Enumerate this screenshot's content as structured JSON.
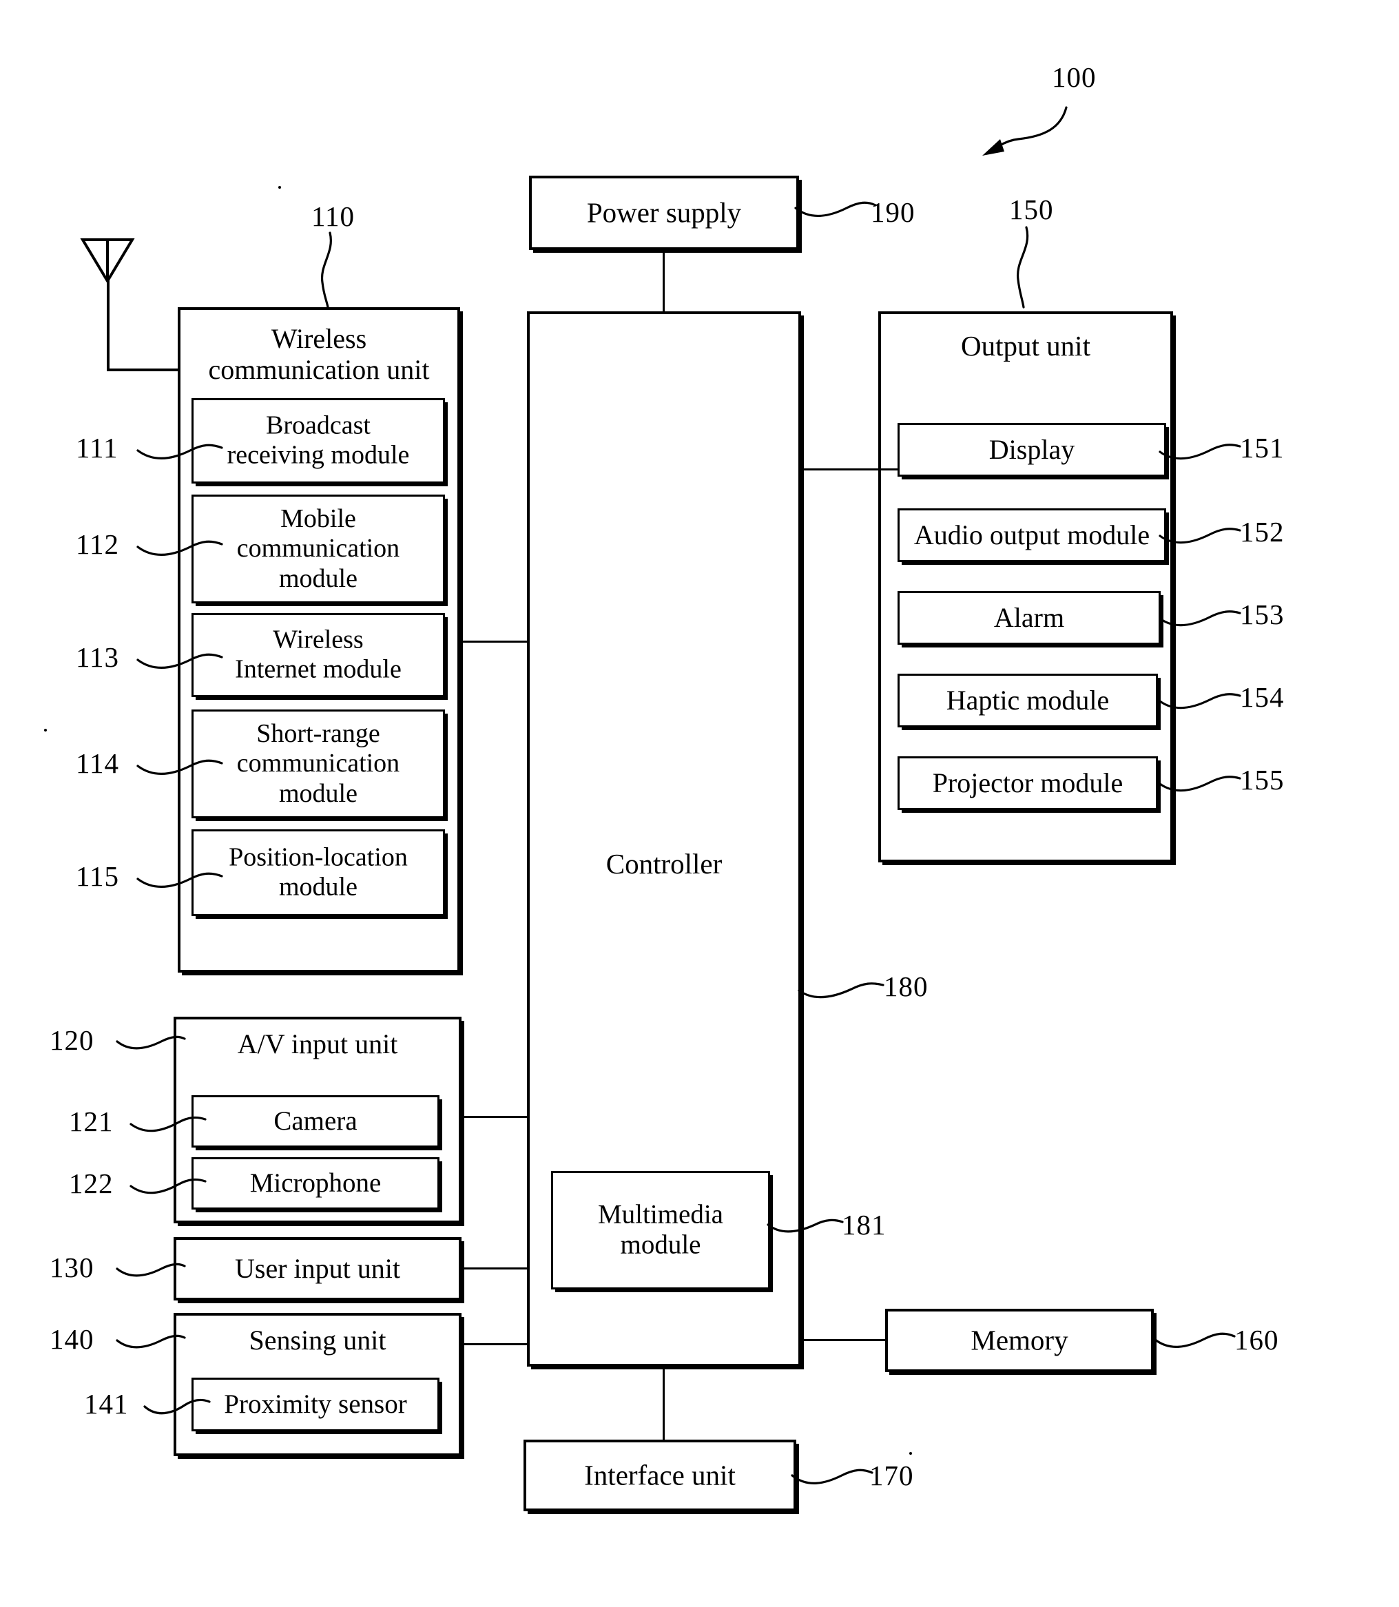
{
  "figure": {
    "device_ref": "100",
    "antenna_icon": "antenna-icon"
  },
  "blocks": {
    "power_supply": {
      "label": "Power supply",
      "ref": "190"
    },
    "controller": {
      "label": "Controller",
      "ref": "180"
    },
    "multimedia_module": {
      "label": "Multimedia\nmodule",
      "ref": "181"
    },
    "memory": {
      "label": "Memory",
      "ref": "160"
    },
    "interface_unit": {
      "label": "Interface unit",
      "ref": "170"
    },
    "user_input_unit": {
      "label": "User input unit",
      "ref": "130"
    }
  },
  "wireless_communication_unit": {
    "title": "Wireless\ncommunication unit",
    "ref": "110",
    "modules": [
      {
        "label": "Broadcast\nreceiving module",
        "ref": "111"
      },
      {
        "label": "Mobile\ncommunication\nmodule",
        "ref": "112"
      },
      {
        "label": "Wireless\nInternet module",
        "ref": "113"
      },
      {
        "label": "Short-range\ncommunication\nmodule",
        "ref": "114"
      },
      {
        "label": "Position-location\nmodule",
        "ref": "115"
      }
    ]
  },
  "output_unit": {
    "title": "Output unit",
    "ref": "150",
    "modules": [
      {
        "label": "Display",
        "ref": "151"
      },
      {
        "label": "Audio output module",
        "ref": "152"
      },
      {
        "label": "Alarm",
        "ref": "153"
      },
      {
        "label": "Haptic module",
        "ref": "154"
      },
      {
        "label": "Projector module",
        "ref": "155"
      }
    ]
  },
  "av_input_unit": {
    "title": "A/V input unit",
    "ref": "120",
    "modules": [
      {
        "label": "Camera",
        "ref": "121"
      },
      {
        "label": "Microphone",
        "ref": "122"
      }
    ]
  },
  "sensing_unit": {
    "title": "Sensing unit",
    "ref": "140",
    "modules": [
      {
        "label": "Proximity sensor",
        "ref": "141"
      }
    ]
  }
}
